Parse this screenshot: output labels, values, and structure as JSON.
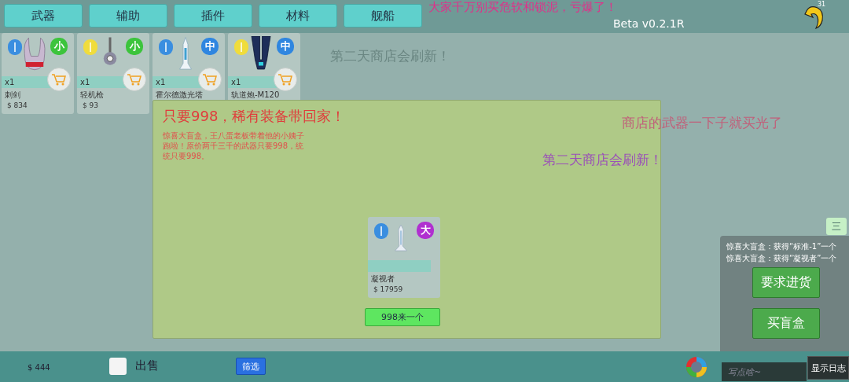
{
  "tabs": [
    {
      "label": "武器"
    },
    {
      "label": "辅助"
    },
    {
      "label": "插件"
    },
    {
      "label": "材料"
    },
    {
      "label": "舰船"
    }
  ],
  "version": "Beta v0.2.1R",
  "notification_count": "31",
  "items": [
    {
      "name": "刺剑",
      "price": "$ 834",
      "quantity": "x1",
      "emblem": {
        "color": "#3a8ee0"
      },
      "size_badge": {
        "text": "小",
        "color": "#3cc43c"
      }
    },
    {
      "name": "轻机枪",
      "price": "$ 93",
      "quantity": "x1",
      "emblem": {
        "color": "#f0dc3c"
      },
      "size_badge": {
        "text": "小",
        "color": "#3cc43c"
      }
    },
    {
      "name": "霍尔德激光塔",
      "quantity": "x1",
      "emblem": {
        "color": "#3a8ee0"
      },
      "size_badge": {
        "text": "中",
        "color": "#2f86e0"
      }
    },
    {
      "name": "轨道炮-M120",
      "quantity": "x1",
      "emblem": {
        "color": "#f0dc3c"
      },
      "size_badge": {
        "text": "中",
        "color": "#2f86e0"
      }
    }
  ],
  "promo": {
    "title": "只要998，稀有装备带回家！",
    "description": "惊喜大盲盒，王八蛋老板带着他的小姨子跑啦！原价两千三千的武器只要998，统统只要998。",
    "item": {
      "name": "凝视者",
      "price": "$ 17959",
      "emblem": {
        "color": "#3a8ee0"
      },
      "size_badge": {
        "text": "大",
        "color": "#b030d0"
      }
    },
    "button": "998来一个"
  },
  "menu_button": "三",
  "log": {
    "lines": [
      "惊喜大盲盒：获得“标准-1”一个",
      "惊喜大盲盒：获得“凝视者”一个"
    ],
    "buttons": [
      "要求进货",
      "买盲盒"
    ]
  },
  "bottom": {
    "money": "$ 444",
    "sell_label": "出售",
    "sell_checked": false,
    "filter_button": "筛选",
    "chat_placeholder": "写点啥~",
    "log_button": "显示日志"
  },
  "danmaku": [
    {
      "text": "第二天商店会刷新！",
      "color": "#6a8682"
    },
    {
      "text": "大家千万别买危软和锁泥，亏爆了！",
      "color": "#e0308a"
    },
    {
      "text": "商店的武器一下子就买光了",
      "color": "#c0607a"
    },
    {
      "text": "第二天商店会刷新！",
      "color": "#9a50b8"
    }
  ]
}
